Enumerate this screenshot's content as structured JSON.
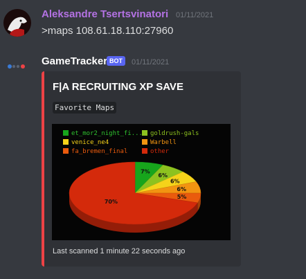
{
  "messages": {
    "user": {
      "name": "Aleksandre Tsertsvinatori",
      "timestamp": "01/11/2021",
      "text": ">maps 108.61.18.110:27960",
      "name_color": "#b472e4"
    },
    "bot": {
      "name": "GameTracker",
      "badge": "BOT",
      "timestamp": "01/11/2021"
    }
  },
  "embed": {
    "title": "F|A RECRUITING XP SAVE",
    "code_label": "Favorite Maps",
    "footer": "Last scanned 1 minute 22 seconds ago",
    "accent_color": "#ed4245"
  },
  "chart_data": {
    "type": "pie",
    "title": "",
    "legend": [
      "et_mor2_night_fi...",
      "goldrush-gals",
      "venice_ne4",
      "Warbell",
      "fa_bremen_final",
      "other"
    ],
    "legend_placement": "top-left",
    "slices": [
      {
        "label": "et_mor2_night_fi...",
        "value": 7,
        "display": "7%",
        "color": "#17a51c"
      },
      {
        "label": "goldrush-gals",
        "value": 6,
        "display": "6%",
        "color": "#8dc21f"
      },
      {
        "label": "venice_ne4",
        "value": 6,
        "display": "6%",
        "color": "#f5d31a"
      },
      {
        "label": "Warbell",
        "value": 6,
        "display": "6%",
        "color": "#f29411"
      },
      {
        "label": "fa_bremen_final",
        "value": 5,
        "display": "5%",
        "color": "#ea5b0d"
      },
      {
        "label": "other",
        "value": 70,
        "display": "70%",
        "color": "#d42a0b"
      }
    ]
  }
}
